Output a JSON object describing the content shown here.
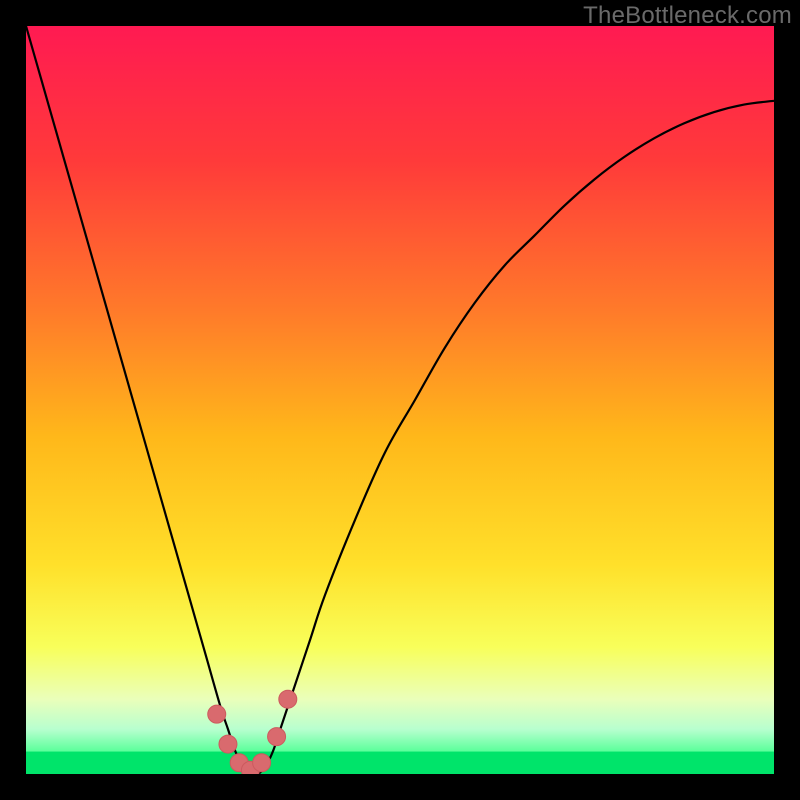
{
  "watermark": "TheBottleneck.com",
  "colors": {
    "frame_bg": "#000000",
    "curve_stroke": "#000000",
    "marker_fill": "#d96a6e",
    "marker_stroke": "#cc5a5e"
  },
  "chart_data": {
    "type": "line",
    "title": "",
    "xlabel": "",
    "ylabel": "",
    "xlim": [
      0,
      100
    ],
    "ylim": [
      0,
      100
    ],
    "grid": false,
    "legend": false,
    "x": [
      0,
      2,
      4,
      6,
      8,
      10,
      12,
      14,
      16,
      18,
      20,
      22,
      24,
      26,
      27,
      28,
      29,
      30,
      31,
      32,
      33,
      34,
      36,
      38,
      40,
      44,
      48,
      52,
      56,
      60,
      64,
      68,
      72,
      76,
      80,
      84,
      88,
      92,
      96,
      100
    ],
    "values": [
      100,
      93,
      86,
      79,
      72,
      65,
      58,
      51,
      44,
      37,
      30,
      23,
      16,
      9,
      6,
      3,
      1,
      0,
      0,
      1,
      3,
      6,
      12,
      18,
      24,
      34,
      43,
      50,
      57,
      63,
      68,
      72,
      76,
      79.5,
      82.5,
      85,
      87,
      88.5,
      89.5,
      90
    ],
    "markers": {
      "x": [
        25.5,
        27,
        28.5,
        30,
        31.5,
        33.5,
        35
      ],
      "y": [
        8,
        4,
        1.5,
        0.5,
        1.5,
        5,
        10
      ]
    },
    "green_band": {
      "ymin": 0,
      "ymax": 3
    },
    "gradient_stops": [
      {
        "offset": 0.0,
        "color": "#ff1a52"
      },
      {
        "offset": 0.18,
        "color": "#ff3a3a"
      },
      {
        "offset": 0.38,
        "color": "#ff7a2a"
      },
      {
        "offset": 0.55,
        "color": "#ffb81a"
      },
      {
        "offset": 0.72,
        "color": "#ffe02a"
      },
      {
        "offset": 0.83,
        "color": "#f8ff5a"
      },
      {
        "offset": 0.9,
        "color": "#eaffba"
      },
      {
        "offset": 0.94,
        "color": "#b8ffcf"
      },
      {
        "offset": 0.97,
        "color": "#5aff9a"
      },
      {
        "offset": 1.0,
        "color": "#00e46a"
      }
    ]
  }
}
